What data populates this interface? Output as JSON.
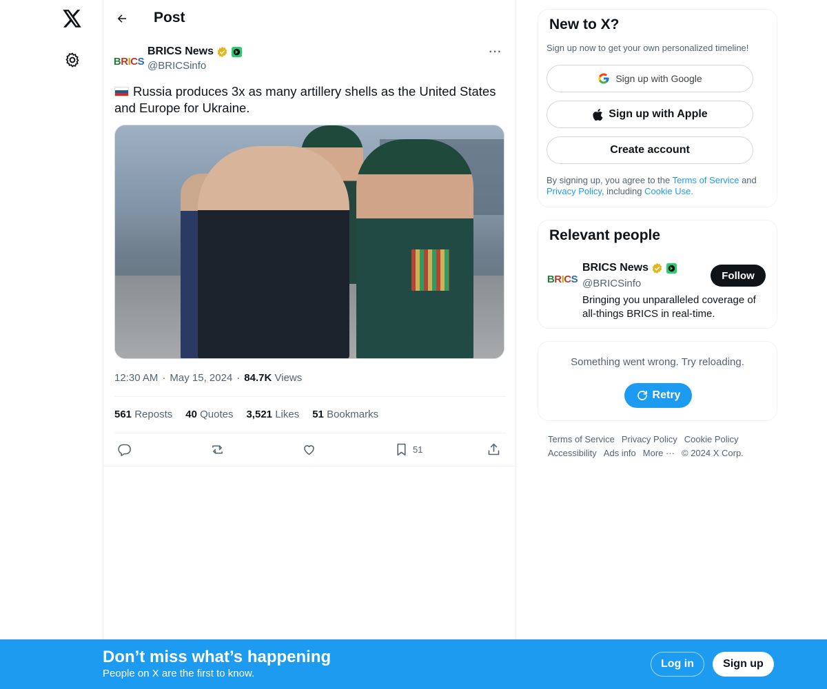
{
  "nav": {
    "logo_icon": "x-logo-icon",
    "settings_icon": "gear-icon"
  },
  "header": {
    "title": "Post",
    "back_icon": "arrow-left-icon"
  },
  "tweet": {
    "author_name": "BRICS News",
    "author_handle": "@BRICSinfo",
    "avatar_text": "BRICS",
    "text": "Russia produces 3x as many artillery shells as the United States and Europe for Ukraine.",
    "flag": "russia-flag",
    "time": "12:30 AM",
    "date": "May 15, 2024",
    "views_count": "84.7K",
    "views_label": "Views",
    "stats": [
      {
        "count": "561",
        "label": "Reposts"
      },
      {
        "count": "40",
        "label": "Quotes"
      },
      {
        "count": "3,521",
        "label": "Likes"
      },
      {
        "count": "51",
        "label": "Bookmarks"
      }
    ],
    "bookmark_count": "51"
  },
  "signup_card": {
    "title": "New to X?",
    "subtitle": "Sign up now to get your own personalized timeline!",
    "google_label": "Sign up with Google",
    "apple_label": "Sign up with Apple",
    "create_label": "Create account",
    "legal_prefix": "By signing up, you agree to the",
    "terms_link": "Terms of Service",
    "and_text": "and",
    "privacy_link": "Privacy Policy",
    "including_text": ", including",
    "cookie_link": "Cookie Use."
  },
  "relevant": {
    "title": "Relevant people",
    "name": "BRICS News",
    "handle": "@BRICSinfo",
    "follow_label": "Follow",
    "bio": "Bringing you unparalleled coverage of all-things BRICS in real-time."
  },
  "error_card": {
    "message": "Something went wrong. Try reloading.",
    "retry_label": "Retry"
  },
  "footer": {
    "links": [
      "Terms of Service",
      "Privacy Policy",
      "Cookie Policy",
      "Accessibility",
      "Ads info",
      "More ···"
    ],
    "copyright": "© 2024 X Corp."
  },
  "banner": {
    "title": "Don’t miss what’s happening",
    "subtitle": "People on X are the first to know.",
    "login_label": "Log in",
    "signup_label": "Sign up"
  },
  "colors": {
    "accent": "#1d9bf0",
    "text": "#0f1419",
    "muted": "#536471",
    "verified_gold": "#e2b719",
    "affiliate_green": "#2ecc71"
  }
}
